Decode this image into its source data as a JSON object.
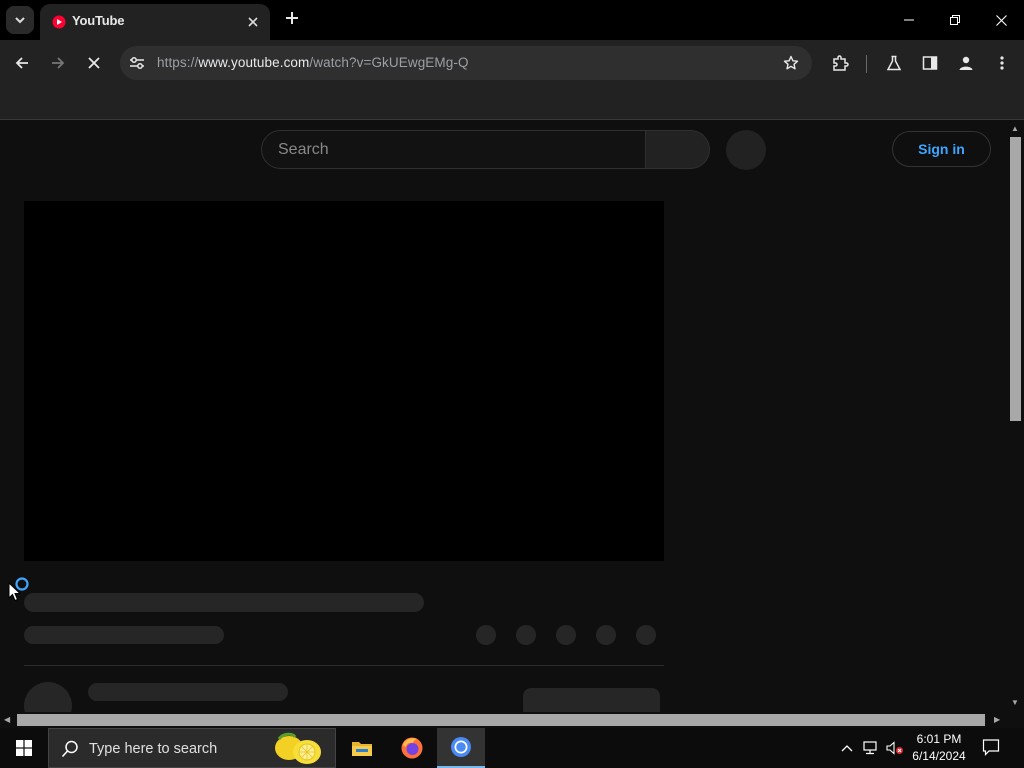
{
  "browser": {
    "tab": {
      "title": "YouTube",
      "favicon": "youtube-favicon"
    },
    "address": {
      "scheme": "https://",
      "host": "www.youtube.com",
      "path": "/watch?v=GkUEwgEMg-Q"
    }
  },
  "page": {
    "search_placeholder": "Search",
    "sign_in_label": "Sign in"
  },
  "taskbar": {
    "search_placeholder": "Type here to search",
    "time": "6:01 PM",
    "date": "6/14/2024"
  },
  "colors": {
    "accent_blue": "#3ea6ff",
    "youtube_red": "#ff0033",
    "page_bg": "#0f0f0f",
    "skeleton": "#262626"
  }
}
